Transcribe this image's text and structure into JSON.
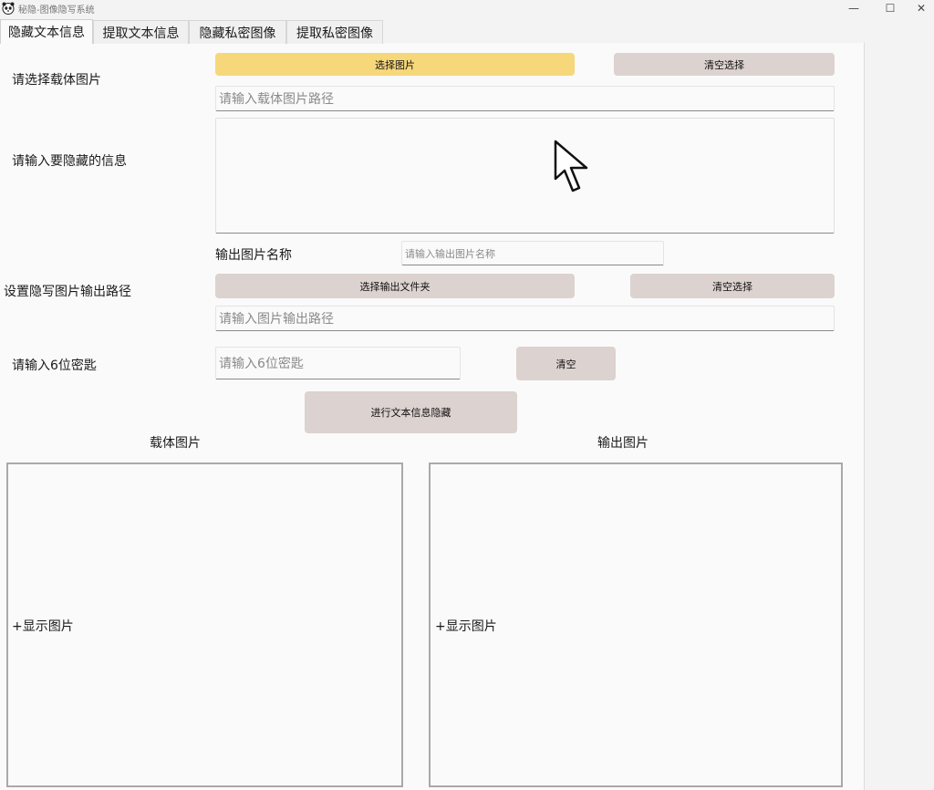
{
  "window": {
    "title": "秘隐-图像隐写系统",
    "minimize": "—",
    "maximize": "☐",
    "close": "✕"
  },
  "tabs": [
    {
      "label": "隐藏文本信息",
      "active": true
    },
    {
      "label": "提取文本信息"
    },
    {
      "label": "隐藏私密图像"
    },
    {
      "label": "提取私密图像"
    }
  ],
  "form": {
    "carrier_label": "请选择载体图片",
    "select_image_button": "选择图片",
    "clear_selection_button": "清空选择",
    "carrier_path_placeholder": "请输入载体图片路径",
    "message_label": "请输入要隐藏的信息",
    "message_value": "",
    "output_name_label": "输出图片名称",
    "output_name_placeholder": "请输入输出图片名称",
    "output_path_label": "设置隐写图片输出路径",
    "select_output_folder_button": "选择输出文件夹",
    "clear_output_button": "清空选择",
    "output_path_placeholder": "请输入图片输出路径",
    "key_label": "请输入6位密匙",
    "key_placeholder": "请输入6位密匙",
    "clear_key_button": "清空",
    "hide_button": "进行文本信息隐藏"
  },
  "preview": {
    "carrier_caption": "载体图片",
    "carrier_text": "+显示图片",
    "output_caption": "输出图片",
    "output_text": "+显示图片"
  },
  "icons": {
    "app": "panda-icon",
    "cursor": "mouse-pointer-icon"
  },
  "colors": {
    "accent_button": "#f6d77a",
    "button": "#dcd2cf"
  }
}
